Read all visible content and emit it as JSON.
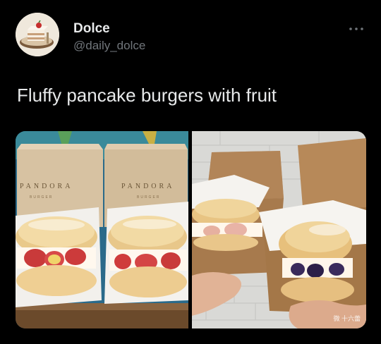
{
  "author": {
    "display_name": "Dolce",
    "handle": "@daily_dolce",
    "avatar_icon": "cake-avatar-icon"
  },
  "menu": {
    "icon": "more-options-icon"
  },
  "tweet": {
    "text": "Fluffy pancake burgers with fruit"
  },
  "media": {
    "left_photo": {
      "box_brand": "PANDORA",
      "box_sub": "BURGER"
    },
    "right_photo": {
      "watermark": "微 十六蕾"
    }
  },
  "colors": {
    "background": "#000000",
    "text_primary": "#e7e9ea",
    "text_secondary": "#71767b"
  }
}
